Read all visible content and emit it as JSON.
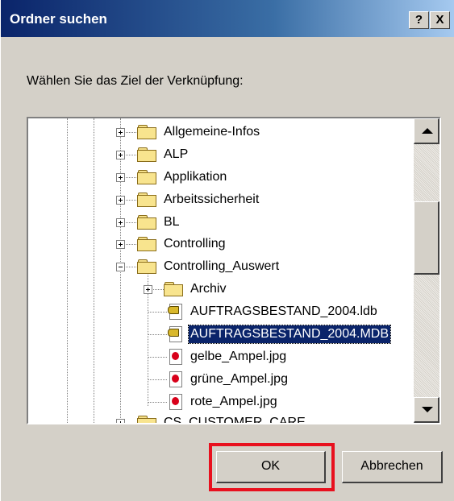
{
  "window": {
    "title": "Ordner suchen",
    "help_label": "?",
    "close_label": "X"
  },
  "prompt": "Wählen Sie das Ziel der Verknüpfung:",
  "tree": {
    "items": [
      {
        "label": "Allgemeine-Infos",
        "icon": "folder-icon",
        "expander": "plus"
      },
      {
        "label": "ALP",
        "icon": "folder-icon",
        "expander": "plus"
      },
      {
        "label": "Applikation",
        "icon": "folder-icon",
        "expander": "plus"
      },
      {
        "label": "Arbeitssicherheit",
        "icon": "folder-icon",
        "expander": "plus"
      },
      {
        "label": "BL",
        "icon": "folder-icon",
        "expander": "plus"
      },
      {
        "label": "Controlling",
        "icon": "folder-icon",
        "expander": "plus"
      },
      {
        "label": "Controlling_Auswert",
        "icon": "folder-open-icon",
        "expander": "minus"
      },
      {
        "label": "Archiv",
        "icon": "folder-icon",
        "expander": "plus"
      },
      {
        "label": "AUFTRAGSBESTAND_2004.ldb",
        "icon": "ldb-file-icon"
      },
      {
        "label": "AUFTRAGSBESTAND_2004.MDB",
        "icon": "mdb-file-icon",
        "selected": true
      },
      {
        "label": "gelbe_Ampel.jpg",
        "icon": "jpg-file-icon"
      },
      {
        "label": "grüne_Ampel.jpg",
        "icon": "jpg-file-icon"
      },
      {
        "label": "rote_Ampel.jpg",
        "icon": "jpg-file-icon"
      },
      {
        "label": "CS_CUSTOMER_CARE",
        "icon": "folder-icon",
        "expander": "plus",
        "partial": true
      }
    ]
  },
  "buttons": {
    "ok_label": "OK",
    "cancel_label": "Abbrechen"
  },
  "colors": {
    "titlebar_start": "#0a246a",
    "selection": "#0a246a",
    "highlight_box": "#e8101e"
  }
}
